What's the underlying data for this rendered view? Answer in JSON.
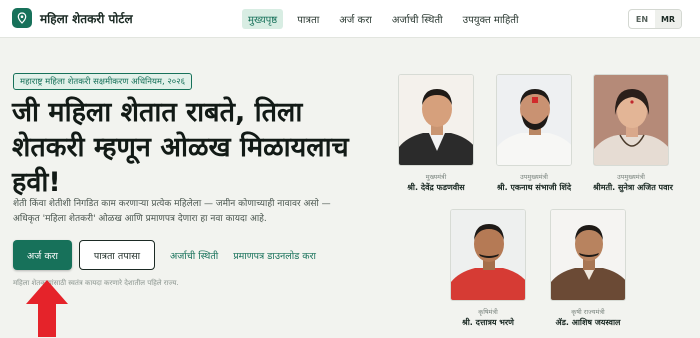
{
  "header": {
    "brand_title": "महिला शेतकरी पोर्टल",
    "nav": [
      {
        "label": "मुख्यपृष्ठ",
        "active": true
      },
      {
        "label": "पात्रता",
        "active": false
      },
      {
        "label": "अर्ज करा",
        "active": false
      },
      {
        "label": "अर्जाची स्थिती",
        "active": false
      },
      {
        "label": "उपयुक्त माहिती",
        "active": false
      }
    ],
    "lang": {
      "en": "EN",
      "mr": "MR",
      "active": "MR"
    }
  },
  "hero": {
    "badge": "महाराष्ट्र महिला शेतकरी सक्षमीकरण अधिनियम, २०२६",
    "headline": "जी महिला शेतात राबते, तिला शेतकरी म्हणून ओळख मिळायलाच हवी!",
    "intro": "शेती किंवा शेतीशी निगडित काम करणाऱ्या प्रत्येक महिलेला — जमीन कोणाच्याही नावावर असो — अधिकृत 'महिला शेतकरी' ओळख आणि प्रमाणपत्र देणारा हा नवा कायदा आहे.",
    "buttons": {
      "apply": "अर्ज करा",
      "check_eligibility": "पात्रता तपासा",
      "application_status": "अर्जाची स्थिती",
      "download_certificate": "प्रमाणपत्र डाउनलोड करा"
    },
    "footnote": "महिला शेतकऱ्यांसाठी स्वतंत्र कायदा करणारे देशातील पहिले राज्य."
  },
  "leaders": [
    {
      "role": "मुख्यमंत्री",
      "name": "श्री. देवेंद्र फडणवीस",
      "bg": "#f4f1ec",
      "shirt": "#2b2b2b"
    },
    {
      "role": "उपमुख्यमंत्री",
      "name": "श्री. एकनाथ संभाजी शिंदे",
      "bg": "#eef0f2",
      "shirt": "#f7f7f5"
    },
    {
      "role": "उपमुख्यमंत्री",
      "name": "श्रीमती. सुनेत्रा अजित पवार",
      "bg": "#b58a78",
      "shirt": "#e6dcd3"
    },
    {
      "role": "कृषिमंत्री",
      "name": "श्री. दत्तात्रय भरणे",
      "bg": "#eef0ef",
      "shirt": "#d63b34"
    },
    {
      "role": "कृषी राज्यमंत्री",
      "name": "ॲड. आशिष जयस्वाल",
      "bg": "#f5f4f2",
      "shirt": "#6b4a35"
    }
  ],
  "colors": {
    "accent": "#17715a",
    "arrow": "#e5232a"
  },
  "icons": {
    "brand": "location-pin-icon",
    "arrow": "arrow-up-icon"
  }
}
